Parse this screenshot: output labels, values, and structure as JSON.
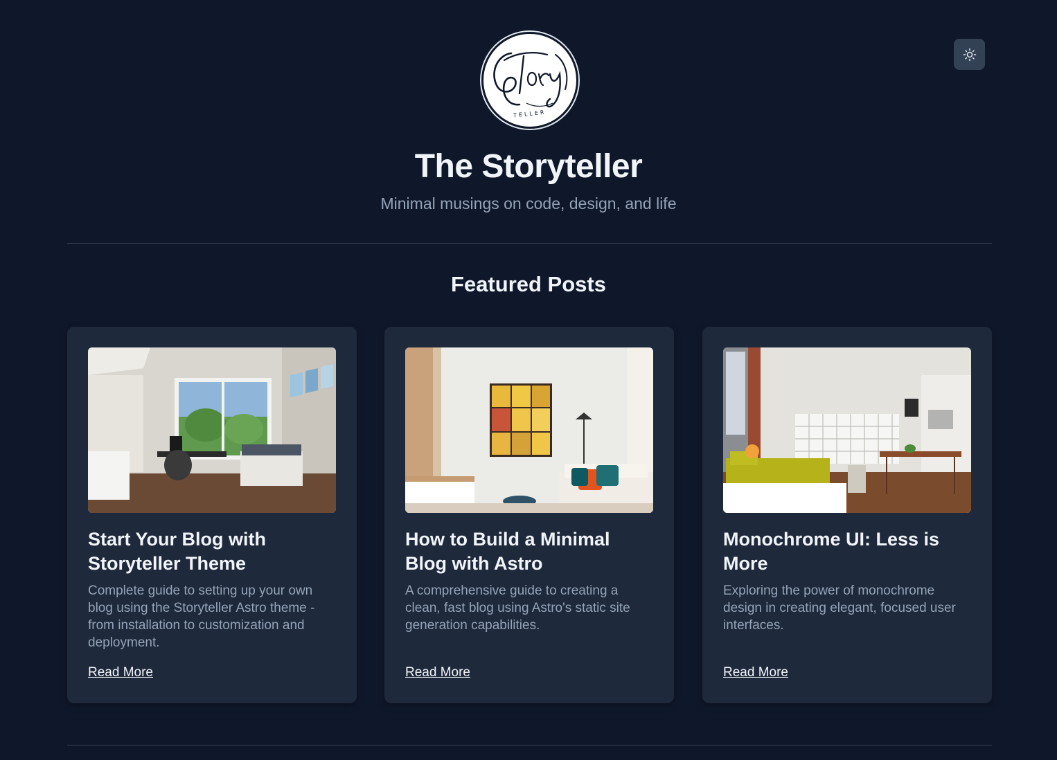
{
  "header": {
    "title": "The Storyteller",
    "tagline": "Minimal musings on code, design, and life",
    "logo": {
      "script_text": "Story",
      "sub_text": "TELLER"
    },
    "theme_toggle_icon": "sun-icon"
  },
  "featured": {
    "heading": "Featured Posts",
    "posts": [
      {
        "title": "Start Your Blog with Storyteller Theme",
        "excerpt": "Complete guide to setting up your own blog using the Storyteller Astro theme - from installation to customization and deployment.",
        "link_label": "Read More"
      },
      {
        "title": "How to Build a Minimal Blog with Astro",
        "excerpt": "A comprehensive guide to creating a clean, fast blog using Astro's static site generation capabilities.",
        "link_label": "Read More"
      },
      {
        "title": "Monochrome UI: Less is More",
        "excerpt": "Exploring the power of monochrome design in creating elegant, focused user interfaces.",
        "link_label": "Read More"
      }
    ]
  },
  "colors": {
    "background": "#0f172a",
    "card": "#1e293b",
    "toggle": "#334155",
    "text": "#f1f5f9",
    "muted": "#94a3b8"
  }
}
